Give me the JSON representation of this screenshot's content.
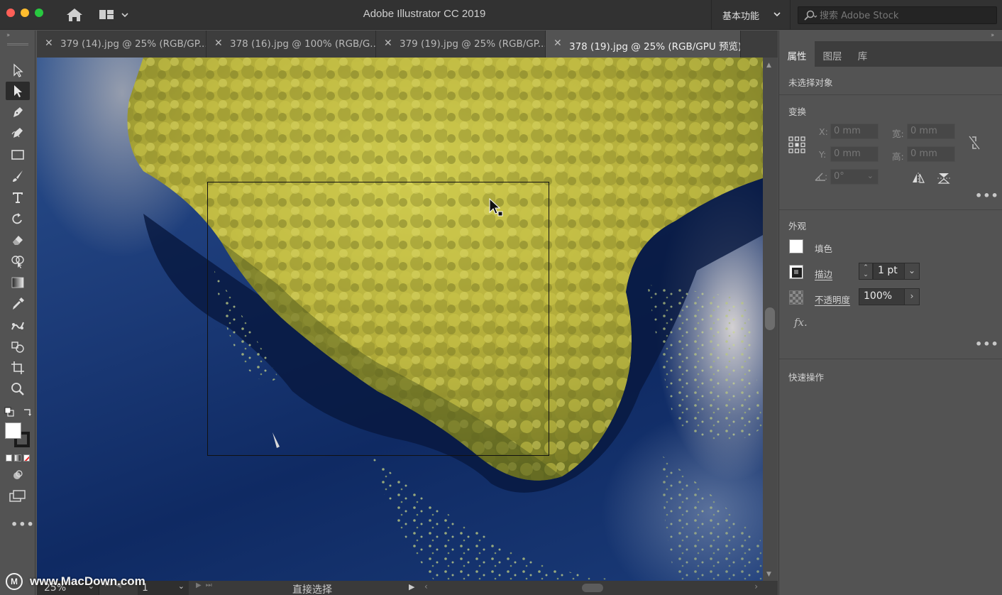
{
  "app": {
    "title": "Adobe Illustrator CC 2019",
    "workspace": "基本功能",
    "stock_search_placeholder": "搜索 Adobe Stock"
  },
  "tabs": [
    {
      "label": "379 (14).jpg @ 25% (RGB/GP...",
      "active": false
    },
    {
      "label": "378 (16).jpg @ 100% (RGB/G...",
      "active": false
    },
    {
      "label": "379 (19).jpg @ 25% (RGB/GP...",
      "active": false
    },
    {
      "label": "378 (19).jpg @ 25% (RGB/GPU 预览)",
      "active": true
    }
  ],
  "tools": [
    "selection-tool",
    "direct-selection-tool",
    "pen-tool",
    "curvature-tool",
    "rectangle-tool",
    "paintbrush-tool",
    "type-tool",
    "rotate-tool",
    "eraser-tool",
    "shape-builder-tool",
    "gradient-tool",
    "eyedropper-tool",
    "blend-tool",
    "symbol-sprayer-tool",
    "artboard-tool",
    "zoom-tool"
  ],
  "status": {
    "zoom": "25%",
    "page": "1",
    "tool_name": "直接选择"
  },
  "panel": {
    "tabs": [
      "属性",
      "图层",
      "库"
    ],
    "no_selection": "未选择对象",
    "transform": {
      "heading": "变换",
      "x_label": "X:",
      "y_label": "Y:",
      "w_label": "宽:",
      "h_label": "高:",
      "x_value": "0 mm",
      "y_value": "0 mm",
      "w_value": "0 mm",
      "h_value": "0 mm",
      "angle_value": "0°"
    },
    "appearance": {
      "heading": "外观",
      "fill_label": "填色",
      "stroke_label": "描边",
      "stroke_value": "1 pt",
      "opacity_label": "不透明度",
      "opacity_value": "100%",
      "fx_label": "fx."
    },
    "quick_actions": "快速操作"
  },
  "watermark": "www.MacDown.com",
  "colors": {
    "chrome_dark": "#323232",
    "panel": "#535353",
    "tab_inactive": "#3d3d3d",
    "water_blue": "#1c3b78",
    "foliage": "#b8b43a"
  }
}
